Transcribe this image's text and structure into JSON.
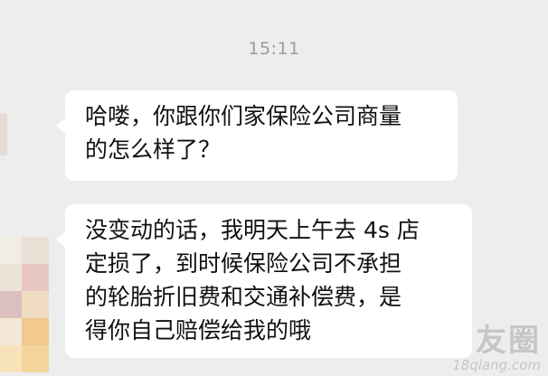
{
  "timestamp": "15:11",
  "messages": [
    {
      "lines": [
        "哈喽，你跟你们家保险公司商量",
        "的怎么样了？"
      ]
    },
    {
      "lines": [
        "没变动的话，我明天上午去 4s 店",
        "定损了，到时候保险公司不承担",
        "的轮胎折旧费和交通补偿费，是",
        "得你自己赔偿给我的哦"
      ]
    }
  ],
  "watermark": {
    "main": "友圈",
    "sub": "18qiang.com"
  },
  "colors": {
    "background": "#ededed",
    "bubble": "#ffffff",
    "text": "#111111",
    "timestamp": "#9b9b9b"
  },
  "avatar_mosaic": [
    "#f1ece6",
    "#ebe0d6",
    "#ede3d9",
    "#e7c6c4",
    "#dcc0bf",
    "#f0dcc0",
    "#f3e9d6",
    "#f2c98e",
    "#f7e2b9",
    "#f3d59c"
  ]
}
